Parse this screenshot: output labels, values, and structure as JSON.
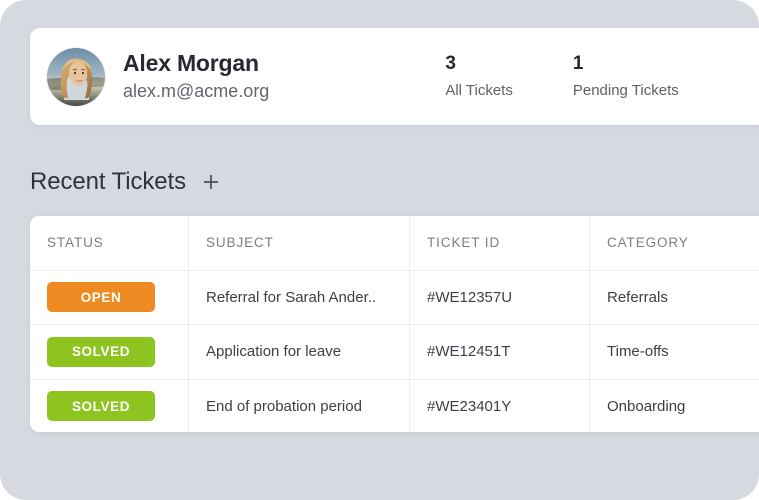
{
  "theme": {
    "page_background": "#d6dae0",
    "card_background": "#ffffff",
    "accent_open": "#ed8b22",
    "accent_solved": "#8dc41f",
    "text_primary": "#26292e",
    "text_secondary": "#61666d"
  },
  "profile": {
    "name": "Alex Morgan",
    "email": "alex.m@acme.org",
    "avatar_alt": "user-avatar-photo",
    "stats": [
      {
        "value": "3",
        "label": "All Tickets"
      },
      {
        "value": "1",
        "label": "Pending Tickets"
      }
    ]
  },
  "section": {
    "title": "Recent Tickets",
    "add_label": "+"
  },
  "table": {
    "headers": {
      "status": "STATUS",
      "subject": "SUBJECT",
      "ticket_id": "TICKET ID",
      "category": "CATEGORY"
    },
    "rows": [
      {
        "status": "OPEN",
        "status_kind": "open",
        "subject": "Referral for Sarah Ander..",
        "ticket_id": "#WE12357U",
        "category": "Referrals"
      },
      {
        "status": "SOLVED",
        "status_kind": "solved",
        "subject": "Application for leave",
        "ticket_id": "#WE12451T",
        "category": "Time-offs"
      },
      {
        "status": "SOLVED",
        "status_kind": "solved",
        "subject": "End of probation period",
        "ticket_id": "#WE23401Y",
        "category": "Onboarding"
      }
    ]
  }
}
